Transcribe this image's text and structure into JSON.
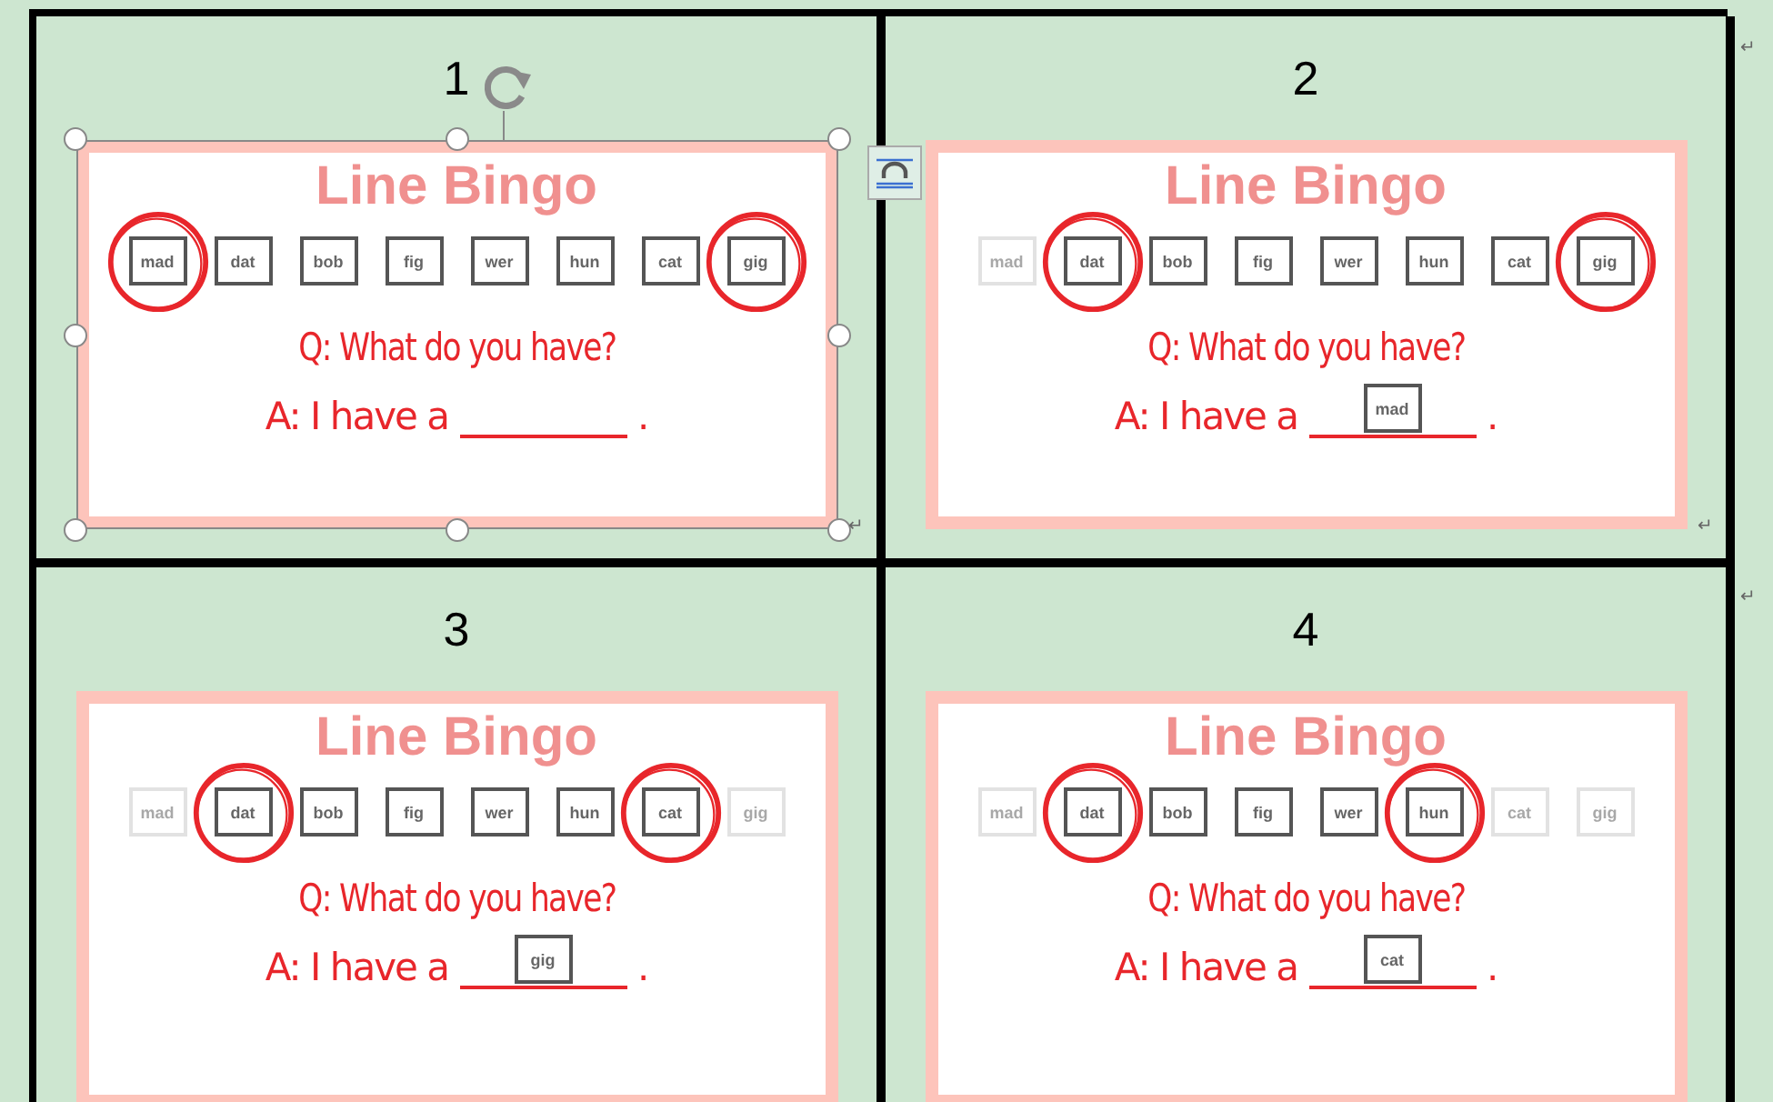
{
  "cells": [
    {
      "number": "1",
      "selected": true,
      "title": "Line Bingo",
      "words": [
        {
          "text": "mad",
          "faded": false,
          "circled": true
        },
        {
          "text": "dat",
          "faded": false,
          "circled": false
        },
        {
          "text": "bob",
          "faded": false,
          "circled": false
        },
        {
          "text": "fig",
          "faded": false,
          "circled": false
        },
        {
          "text": "wer",
          "faded": false,
          "circled": false
        },
        {
          "text": "hun",
          "faded": false,
          "circled": false
        },
        {
          "text": "cat",
          "faded": false,
          "circled": false
        },
        {
          "text": "gig",
          "faded": false,
          "circled": true
        }
      ],
      "question": "Q: What do you have?",
      "answer": "A: I have a",
      "end": ".",
      "mark": "↵"
    },
    {
      "number": "2",
      "selected": false,
      "title": "Line Bingo",
      "words": [
        {
          "text": "mad",
          "faded": true,
          "circled": false
        },
        {
          "text": "dat",
          "faded": false,
          "circled": true
        },
        {
          "text": "bob",
          "faded": false,
          "circled": false
        },
        {
          "text": "fig",
          "faded": false,
          "circled": false
        },
        {
          "text": "wer",
          "faded": false,
          "circled": false
        },
        {
          "text": "hun",
          "faded": false,
          "circled": false
        },
        {
          "text": "cat",
          "faded": false,
          "circled": false
        },
        {
          "text": "gig",
          "faded": false,
          "circled": true
        }
      ],
      "question": "Q: What do you have?",
      "answer": "A: I have a",
      "answer_word": "mad",
      "end": ".",
      "mark": "↵"
    },
    {
      "number": "3",
      "selected": false,
      "title": "Line Bingo",
      "words": [
        {
          "text": "mad",
          "faded": true,
          "circled": false
        },
        {
          "text": "dat",
          "faded": false,
          "circled": true
        },
        {
          "text": "bob",
          "faded": false,
          "circled": false
        },
        {
          "text": "fig",
          "faded": false,
          "circled": false
        },
        {
          "text": "wer",
          "faded": false,
          "circled": false
        },
        {
          "text": "hun",
          "faded": false,
          "circled": false
        },
        {
          "text": "cat",
          "faded": false,
          "circled": true
        },
        {
          "text": "gig",
          "faded": true,
          "circled": false
        }
      ],
      "question": "Q: What do you have?",
      "answer": "A: I have a",
      "answer_word": "gig",
      "end": "."
    },
    {
      "number": "4",
      "selected": false,
      "title": "Line Bingo",
      "words": [
        {
          "text": "mad",
          "faded": true,
          "circled": false
        },
        {
          "text": "dat",
          "faded": false,
          "circled": true
        },
        {
          "text": "bob",
          "faded": false,
          "circled": false
        },
        {
          "text": "fig",
          "faded": false,
          "circled": false
        },
        {
          "text": "wer",
          "faded": false,
          "circled": false
        },
        {
          "text": "hun",
          "faded": false,
          "circled": true
        },
        {
          "text": "cat",
          "faded": true,
          "circled": false
        },
        {
          "text": "gig",
          "faded": true,
          "circled": false
        }
      ],
      "question": "Q: What do you have?",
      "answer": "A: I have a",
      "answer_word": "cat",
      "end": "."
    }
  ],
  "row_marks": [
    "↵",
    "↵"
  ]
}
